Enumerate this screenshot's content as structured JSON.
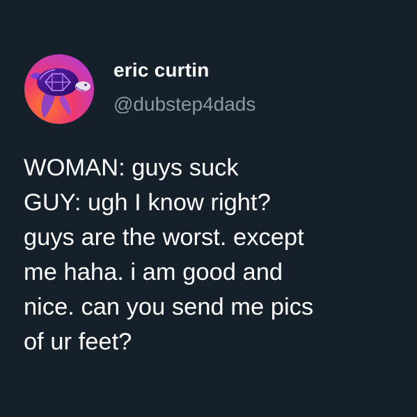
{
  "tweet": {
    "author": {
      "display_name": "eric curtin",
      "handle": "@dubstep4dads",
      "avatar_icon": "sea-turtle-avatar-icon"
    },
    "text_lines": [
      "WOMAN: guys suck",
      "GUY: ugh I know right?",
      "guys are the worst. except",
      "me haha. i am good and",
      "nice. can you send me pics",
      "of ur feet?"
    ]
  },
  "colors": {
    "background": "#15202b",
    "primary_text": "#ffffff",
    "secondary_text": "#8899a6",
    "avatar_gradient": [
      "#ff6a3d",
      "#e0318a",
      "#7a2fd1"
    ]
  }
}
